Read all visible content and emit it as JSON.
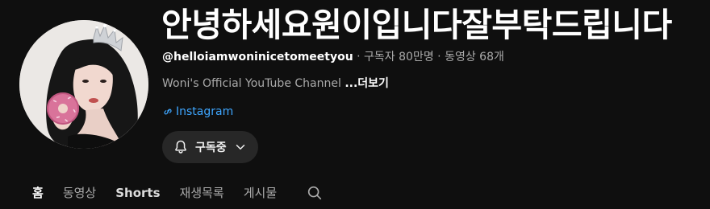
{
  "channel": {
    "title": "안녕하세요원이입니다잘부탁드립니다",
    "handle": "@helloiamwoninicetomeetyou",
    "separator": "‧",
    "subscribers": "구독자 80만명",
    "videos": "동영상 68개",
    "description": "Woni's Official YouTube Channel",
    "more_label": "...더보기",
    "link_label": "Instagram",
    "link_color": "#3ea6ff"
  },
  "subscribe_button": {
    "label": "구독중",
    "icon_left": "bell-icon",
    "icon_right": "chevron-down-icon"
  },
  "tabs": [
    {
      "label": "홈",
      "active": true
    },
    {
      "label": "동영상",
      "active": false
    },
    {
      "label": "Shorts",
      "active": false
    },
    {
      "label": "재생목록",
      "active": false
    },
    {
      "label": "게시물",
      "active": false
    }
  ],
  "tab_search_icon": "search-icon",
  "colors": {
    "background": "#0f0f0f",
    "button_bg": "#272727",
    "secondary_text": "#aaaaaa"
  }
}
